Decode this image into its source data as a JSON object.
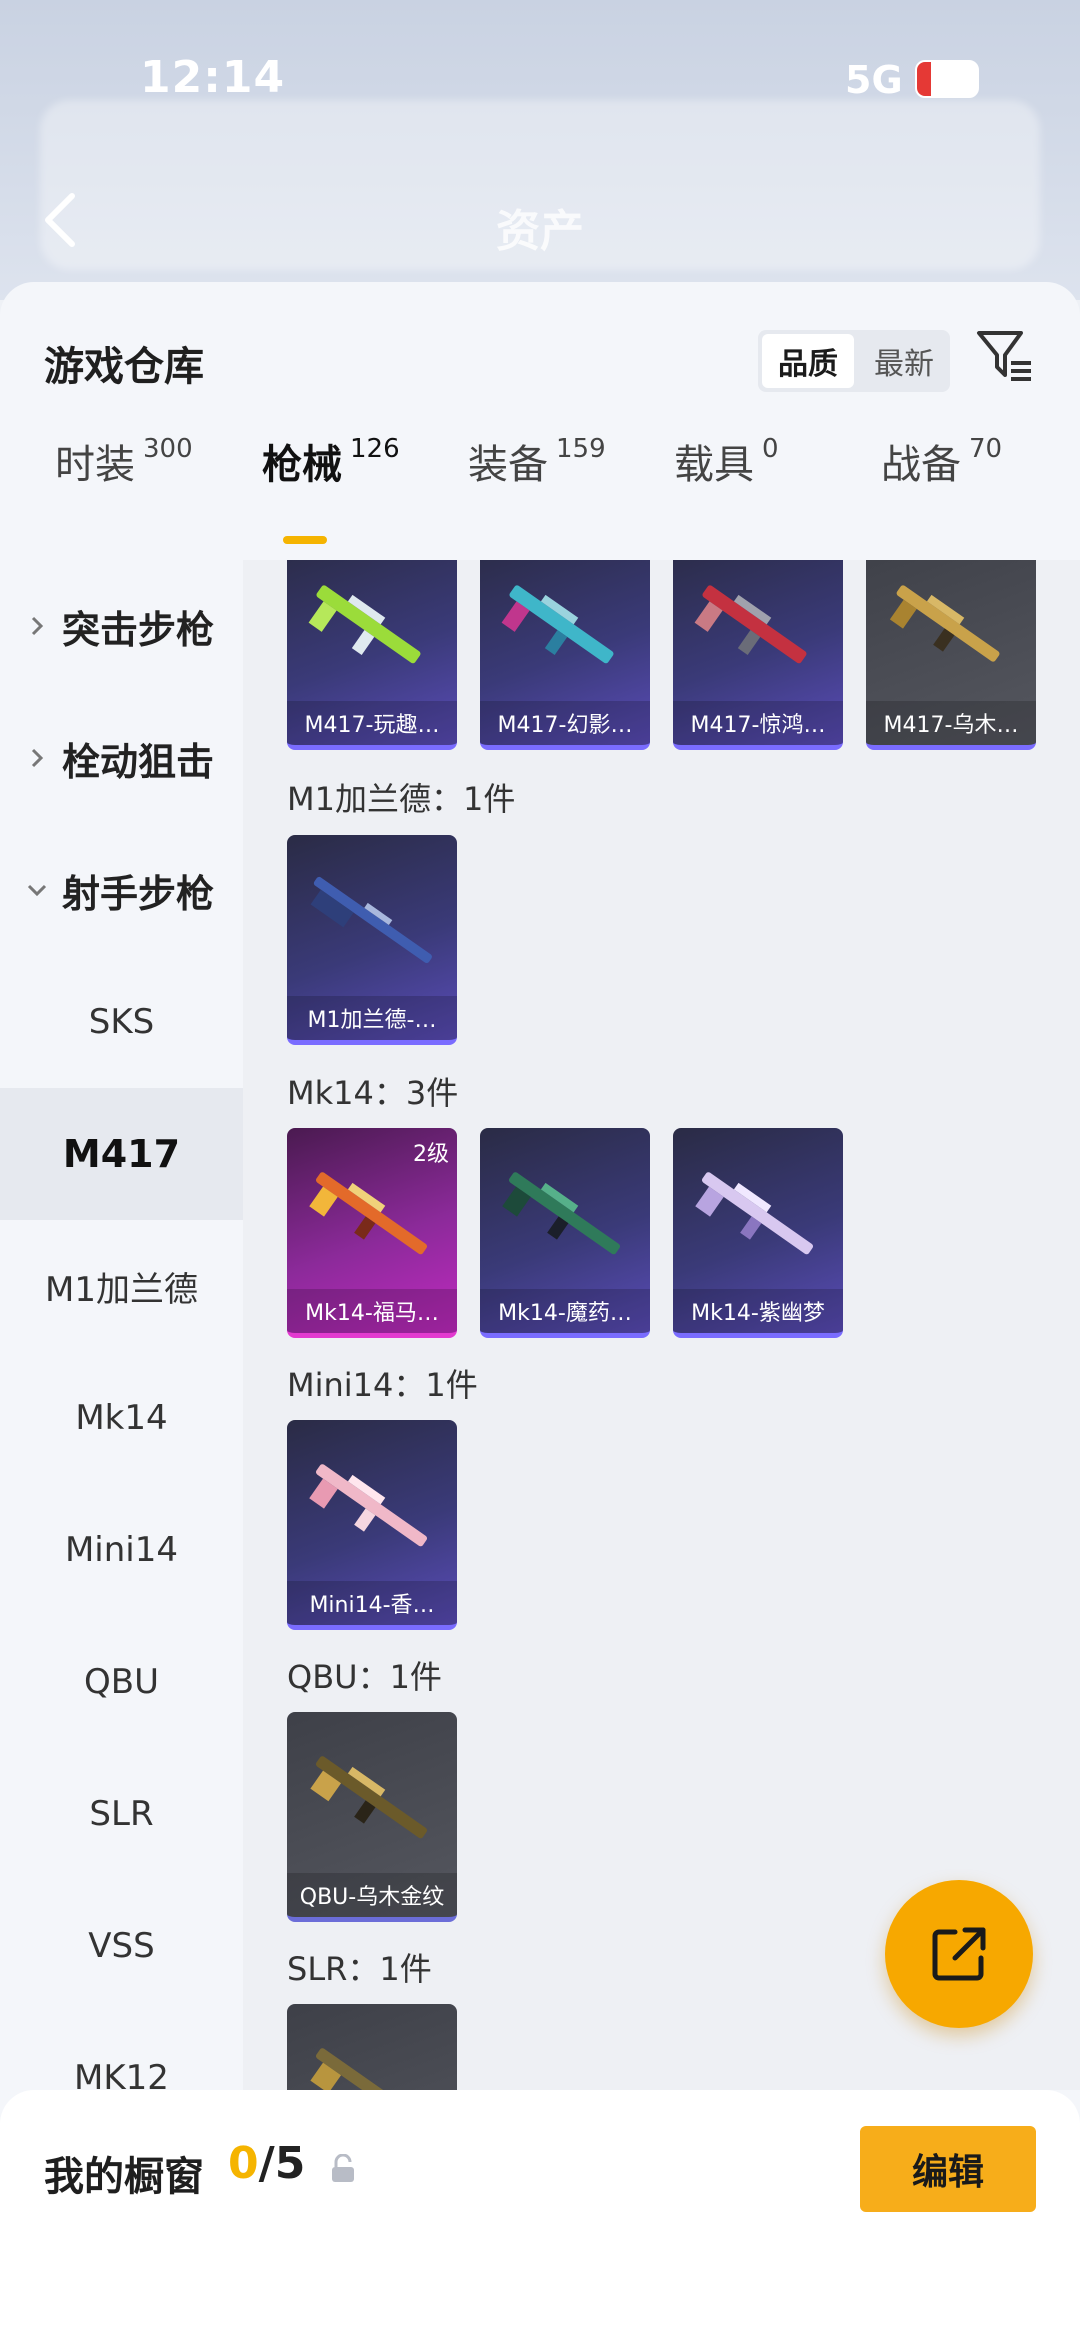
{
  "status": {
    "time": "12:14",
    "network": "5G"
  },
  "nav": {
    "title": "资产"
  },
  "panel": {
    "title": "游戏仓库",
    "sort": {
      "options": [
        "品质",
        "最新"
      ],
      "selected": "品质"
    }
  },
  "tabs": [
    {
      "label": "时装",
      "count": "300"
    },
    {
      "label": "枪械",
      "count": "126",
      "active": true
    },
    {
      "label": "装备",
      "count": "159"
    },
    {
      "label": "载具",
      "count": "0"
    },
    {
      "label": "战备",
      "count": "70"
    }
  ],
  "sidebar": {
    "groups": [
      {
        "label": "突击步枪",
        "expanded": false
      },
      {
        "label": "栓动狙击",
        "expanded": false
      },
      {
        "label": "射手步枪",
        "expanded": true
      }
    ],
    "items": [
      "SKS",
      "M417",
      "M1加兰德",
      "Mk14",
      "Mini14",
      "QBU",
      "SLR",
      "VSS",
      "MK12"
    ],
    "active": "M417"
  },
  "content": {
    "groups": [
      {
        "label": "",
        "items": [
          {
            "name": "M417-玩趣…",
            "rarity": "purple"
          },
          {
            "name": "M417-幻影…",
            "rarity": "purple"
          },
          {
            "name": "M417-惊鸿…",
            "rarity": "purple"
          },
          {
            "name": "M417-乌木…",
            "rarity": "gray"
          }
        ]
      },
      {
        "label": "M1加兰德：1件",
        "items": [
          {
            "name": "M1加兰德-…",
            "rarity": "purple"
          }
        ]
      },
      {
        "label": "Mk14：3件",
        "items": [
          {
            "name": "Mk14-福马…",
            "rarity": "pink",
            "level": "2级"
          },
          {
            "name": "Mk14-魔药…",
            "rarity": "purple"
          },
          {
            "name": "Mk14-紫幽梦",
            "rarity": "purple"
          }
        ]
      },
      {
        "label": "Mini14：1件",
        "items": [
          {
            "name": "Mini14-香…",
            "rarity": "purple"
          }
        ]
      },
      {
        "label": "QBU：1件",
        "items": [
          {
            "name": "QBU-乌木金纹",
            "rarity": "gray"
          }
        ]
      },
      {
        "label": "SLR：1件",
        "items": [
          {
            "name": "",
            "rarity": "gray"
          }
        ]
      }
    ]
  },
  "showcase": {
    "label": "我的橱窗",
    "current": "0",
    "separator": "/",
    "max": "5"
  },
  "actions": {
    "edit": "编辑"
  },
  "colors": {
    "accent": "#f5b400",
    "button": "#f7ad1a",
    "pink_rarity": "#c02ac0",
    "purple_rarity": "#5a4cb8"
  }
}
